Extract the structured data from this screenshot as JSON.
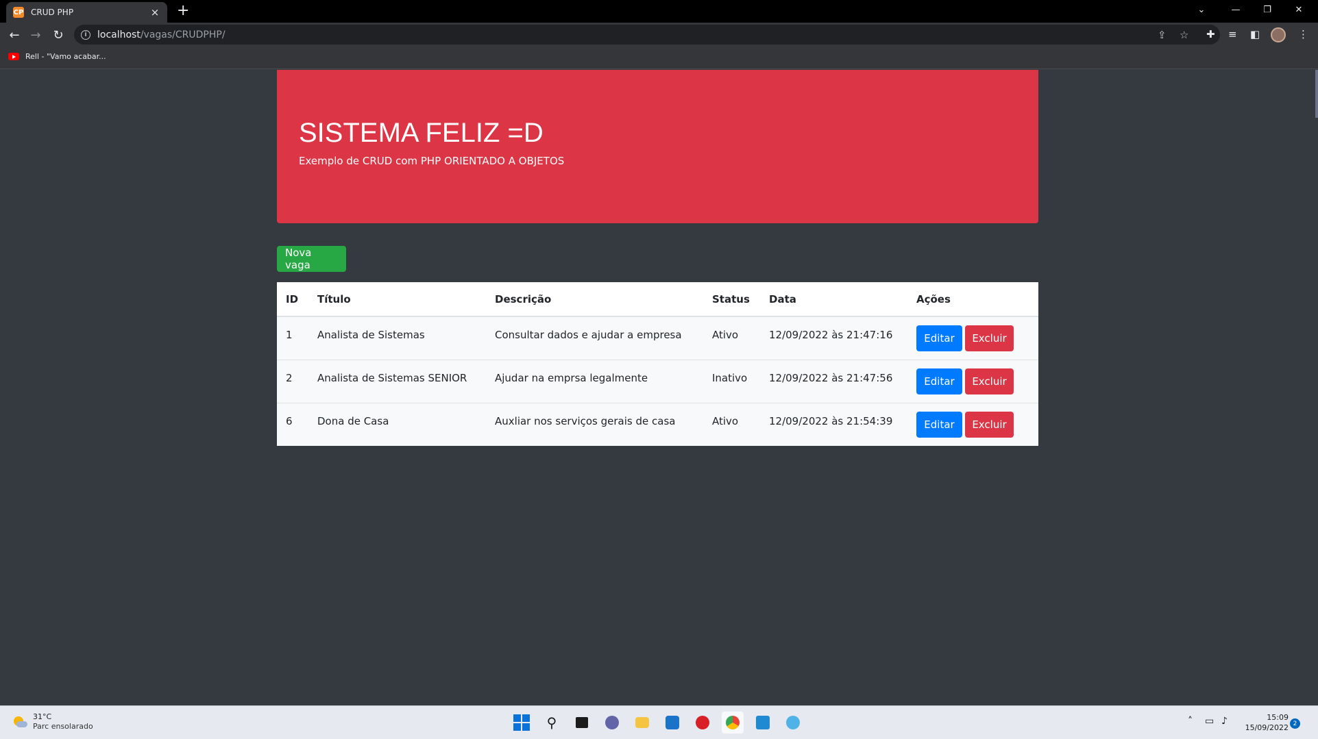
{
  "browser": {
    "tab_title": "CRUD PHP",
    "tab_favicon_text": "CP",
    "close_glyph": "×",
    "new_tab_glyph": "+",
    "url_host": "localhost",
    "url_path": "/vagas/CRUDPHP/",
    "bookmark": "Rell - \"Vamo acabar..."
  },
  "header": {
    "title": "SISTEMA FELIZ =D",
    "subtitle": "Exemplo de CRUD com PHP ORIENTADO A OBJETOS"
  },
  "actions": {
    "new_label": "Nova vaga"
  },
  "table": {
    "headers": [
      "ID",
      "Título",
      "Descrição",
      "Status",
      "Data",
      "Ações"
    ],
    "rows": [
      {
        "id": "1",
        "titulo": "Analista de Sistemas",
        "descricao": "Consultar dados e ajudar a empresa",
        "status": "Ativo",
        "data": "12/09/2022 às 21:47:16"
      },
      {
        "id": "2",
        "titulo": "Analista de Sistemas SENIOR",
        "descricao": "Ajudar na emprsa legalmente",
        "status": "Inativo",
        "data": "12/09/2022 às 21:47:56"
      },
      {
        "id": "6",
        "titulo": "Dona de Casa",
        "descricao": "Auxliar nos serviços gerais de casa",
        "status": "Ativo",
        "data": "12/09/2022 às 21:54:39"
      }
    ],
    "edit_label": "Editar",
    "delete_label": "Excluir"
  },
  "taskbar": {
    "temperature": "31°C",
    "weather": "Parc ensolarado",
    "time": "15:09",
    "date": "15/09/2022",
    "notifications": "2"
  },
  "colors": {
    "header_bg": "#dc3545",
    "page_bg": "#343a40",
    "success": "#28a745",
    "primary": "#007bff",
    "danger": "#dc3545"
  }
}
